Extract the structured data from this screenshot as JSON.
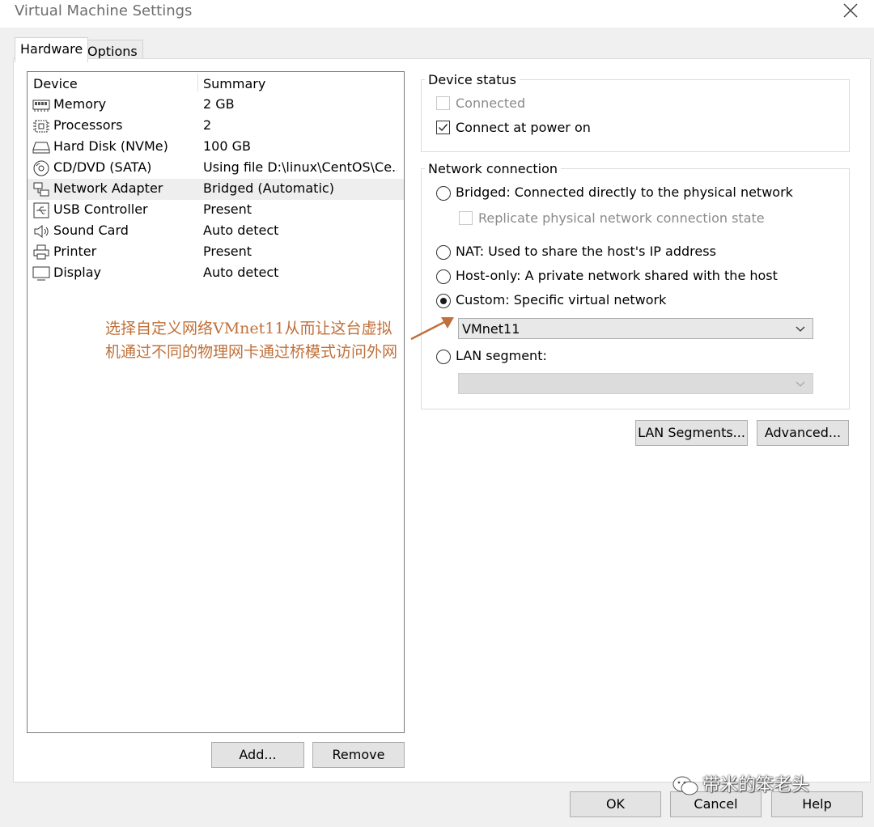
{
  "window": {
    "title": "Virtual Machine Settings",
    "close_icon": "close-icon"
  },
  "tabs": [
    {
      "label": "Hardware",
      "active": true
    },
    {
      "label": "Options",
      "active": false
    }
  ],
  "device_list": {
    "headers": {
      "device": "Device",
      "summary": "Summary"
    },
    "rows": [
      {
        "name": "Memory",
        "summary": "2 GB",
        "icon": "memory-icon"
      },
      {
        "name": "Processors",
        "summary": "2",
        "icon": "processor-icon"
      },
      {
        "name": "Hard Disk (NVMe)",
        "summary": "100 GB",
        "icon": "hard-disk-icon"
      },
      {
        "name": "CD/DVD (SATA)",
        "summary": "Using file D:\\linux\\CentOS\\Ce...",
        "icon": "cd-dvd-icon"
      },
      {
        "name": "Network Adapter",
        "summary": "Bridged (Automatic)",
        "icon": "network-adapter-icon",
        "selected": true
      },
      {
        "name": "USB Controller",
        "summary": "Present",
        "icon": "usb-icon"
      },
      {
        "name": "Sound Card",
        "summary": "Auto detect",
        "icon": "sound-icon"
      },
      {
        "name": "Printer",
        "summary": "Present",
        "icon": "printer-icon"
      },
      {
        "name": "Display",
        "summary": "Auto detect",
        "icon": "display-icon"
      }
    ]
  },
  "left_buttons": {
    "add": "Add...",
    "remove": "Remove"
  },
  "device_status": {
    "label": "Device status",
    "connected": {
      "label": "Connected",
      "checked": false,
      "disabled": true
    },
    "connect_power_on": {
      "label": "Connect at power on",
      "checked": true
    }
  },
  "network_connection": {
    "label": "Network connection",
    "bridged": "Bridged: Connected directly to the physical network",
    "replicate": "Replicate physical network connection state",
    "nat": "NAT: Used to share the host's IP address",
    "host_only": "Host-only: A private network shared with the host",
    "custom": "Custom: Specific virtual network",
    "custom_value": "VMnet11",
    "lan_segment": "LAN segment:",
    "lan_segment_value": "",
    "selected": "custom"
  },
  "net_buttons": {
    "lan_segments": "LAN Segments...",
    "advanced": "Advanced..."
  },
  "annotation": "选择自定义网络VMnet11从而让这台虚拟机通过不同的物理网卡通过桥模式访问外网",
  "footer": {
    "ok": "OK",
    "cancel": "Cancel",
    "help": "Help"
  },
  "watermark": "带米的笨老头",
  "colors": {
    "annotation": "#c0703a",
    "selected_row": "#eeeeee",
    "button_face": "#e3e3e3"
  }
}
